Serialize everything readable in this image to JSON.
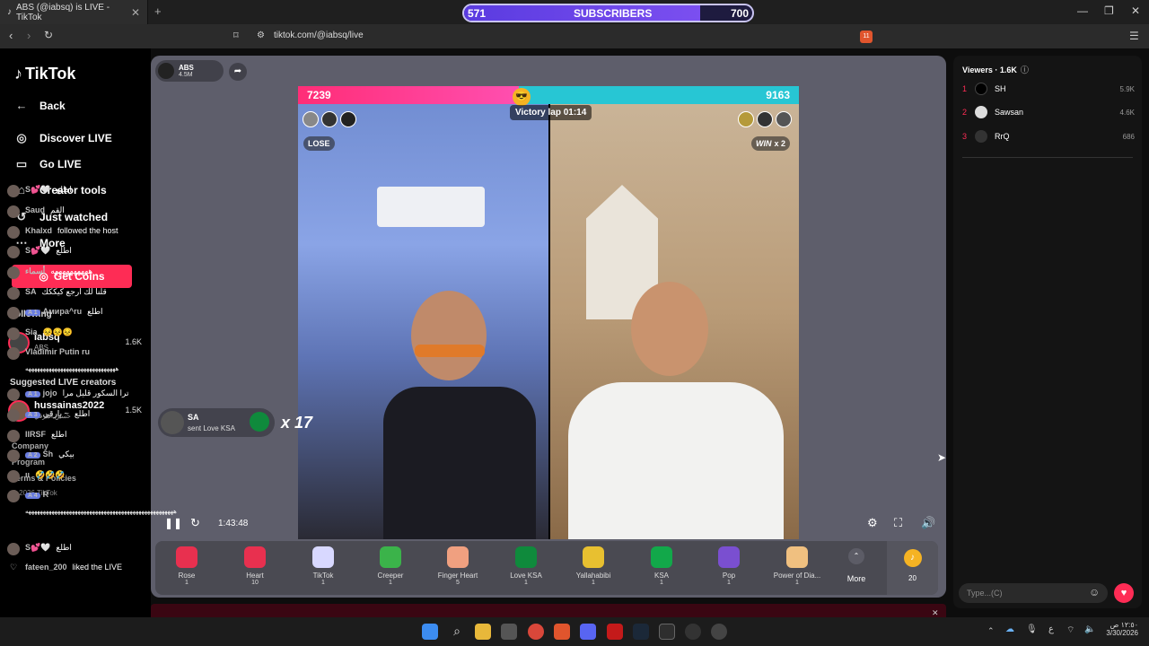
{
  "browser": {
    "tab_title": "ABS (@iabsq) is LIVE - TikTok",
    "url": "tiktok.com/@iabsq/live",
    "ext_badge": "11"
  },
  "subs_overlay": {
    "left": "571",
    "label": "SUBSCRIBERS",
    "right": "700",
    "progress": 0.82
  },
  "nav": {
    "logo": "TikTok",
    "items": [
      {
        "label": "Back",
        "icon": "arrow-left-icon"
      },
      {
        "label": "Discover LIVE",
        "icon": "live-icon"
      },
      {
        "label": "Go LIVE",
        "icon": "camera-icon"
      },
      {
        "label": "Creator tools",
        "icon": "home-icon"
      },
      {
        "label": "Just watched",
        "icon": "history-icon"
      },
      {
        "label": "More",
        "icon": "ellipsis-icon"
      }
    ],
    "coins": "Get Coins"
  },
  "following": {
    "heading": "Following",
    "items": [
      {
        "name": "iabsq",
        "sub": "ABS",
        "count": "1.6K"
      }
    ]
  },
  "suggested": {
    "heading": "Suggested LIVE creators",
    "items": [
      {
        "name": "hussainas2022",
        "sub": "حسين البارقي",
        "count": "1.5K"
      }
    ]
  },
  "footer": {
    "links": [
      "Company",
      "Program",
      "Terms & Policies"
    ],
    "copyright": "© 2026 TikTok"
  },
  "host": {
    "name": "ABS",
    "likes": "4.5M"
  },
  "battle": {
    "left_score": "7239",
    "right_score": "9163",
    "left_fraction": 0.44,
    "timer": "Victory lap 01:14",
    "left_result": "LOSE",
    "right_result": "WIN",
    "right_mult": "x 2"
  },
  "gift_notice": {
    "user": "SA",
    "text": "sent Love KSA",
    "combo": "x 17"
  },
  "player": {
    "time": "1:43:48"
  },
  "gifts": [
    {
      "name": "Rose",
      "price": "1",
      "color": "#e8304f"
    },
    {
      "name": "Heart",
      "price": "10",
      "color": "#e8304f"
    },
    {
      "name": "TikTok",
      "price": "1",
      "color": "#d8d8ff"
    },
    {
      "name": "Creeper",
      "price": "1",
      "color": "#3bb34a"
    },
    {
      "name": "Finger Heart",
      "price": "5",
      "color": "#f0a080"
    },
    {
      "name": "Love KSA",
      "price": "1",
      "color": "#0f8a3c"
    },
    {
      "name": "Yallahabibi",
      "price": "1",
      "color": "#e8c030"
    },
    {
      "name": "KSA",
      "price": "1",
      "color": "#12a84a"
    },
    {
      "name": "Pop",
      "price": "1",
      "color": "#7a4fd0"
    },
    {
      "name": "Power of Dia...",
      "price": "1",
      "color": "#f0c080"
    }
  ],
  "gift_more": "More",
  "gift_coin_count": "20",
  "viewers": {
    "title": "Viewers · 1.6K",
    "top": [
      {
        "rank": "1",
        "name": "SH",
        "count": "5.9K"
      },
      {
        "rank": "2",
        "name": "Sawsan",
        "count": "4.6K"
      },
      {
        "rank": "3",
        "name": "RrQ",
        "count": "686"
      }
    ]
  },
  "chat": [
    {
      "name": "S💕🤍",
      "text": "اطلع"
    },
    {
      "name": "Saud",
      "text": "القم"
    },
    {
      "name": "Khalxd",
      "text": "followed the host"
    },
    {
      "name": "S💕🤍",
      "text": "اطلع"
    },
    {
      "name": "أسماء",
      "text": "ههههههههههه"
    },
    {
      "name": "SA",
      "text": "قلنا لك ارجع كيككك"
    },
    {
      "level": "A 1",
      "name": "Амира^ru",
      "text": "اطلع"
    },
    {
      "name": "Sia",
      "text": "😣😣😣"
    },
    {
      "name": "Vladimir Putin ru",
      "text": "هههههههههههههههههههههههههههههههه"
    },
    {
      "level": "A 1",
      "name": "jojo",
      "text": "ترا السكور قليل مرا"
    },
    {
      "level": "A 3",
      "name": "بارقي ~",
      "text": "اطلع"
    },
    {
      "name": "IIRSF",
      "text": "اطلع"
    },
    {
      "level": "A 2",
      "name": "Sh",
      "text": "بيكي"
    },
    {
      "name": "ıı",
      "text": "🤣🤣🤣"
    },
    {
      "level": "A 4",
      "name": "R",
      "text": "هههههههههههههههههههههههههههههههههههههههههههههههههههه"
    },
    {
      "name": "S💕🤍",
      "text": "اطلع"
    },
    {
      "name": "fateen_200",
      "text": "liked the LIVE"
    }
  ],
  "input_placeholder": "Type...(C)",
  "taskbar": {
    "time": "١٢:٥٠ ص",
    "date": "3/30/2026"
  }
}
